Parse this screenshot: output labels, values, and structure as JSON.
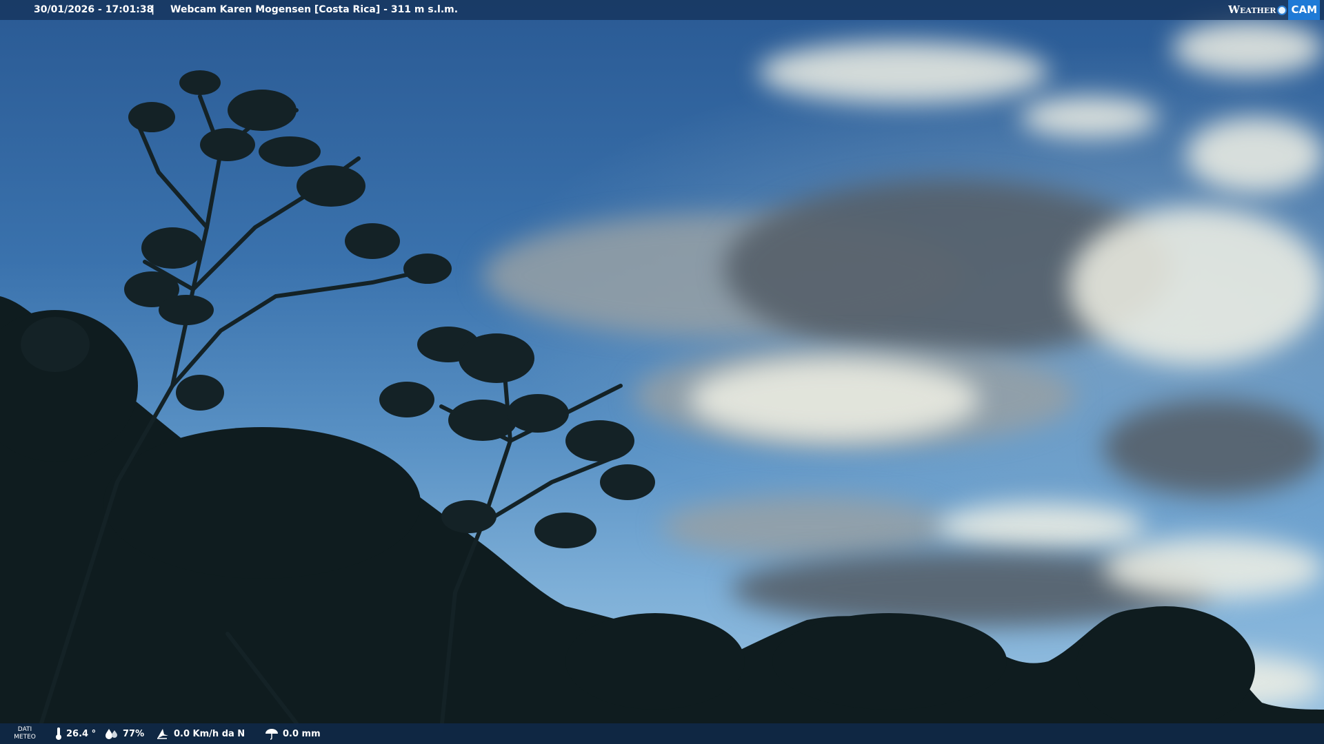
{
  "header": {
    "datetime": "30/01/2026 - 17:01:38",
    "separator": "|",
    "title": "Webcam Karen Mogensen [Costa Rica]  - 311 m s.l.m.",
    "logo_left": "Weather",
    "logo_right": "CAM"
  },
  "footer": {
    "dati_line1": "DATI",
    "dati_line2": "METEO",
    "temperature": "26.4 °",
    "humidity": "77%",
    "wind": "0.0 Km/h da N",
    "rain": "0.0 mm"
  },
  "icons": [
    "thermometer-icon",
    "humidity-drop-icon",
    "wind-icon",
    "rain-umbrella-icon"
  ],
  "colors": {
    "bar_bg": "#14325a",
    "logo_accent": "#1f7ad6",
    "text": "#ffffff"
  }
}
